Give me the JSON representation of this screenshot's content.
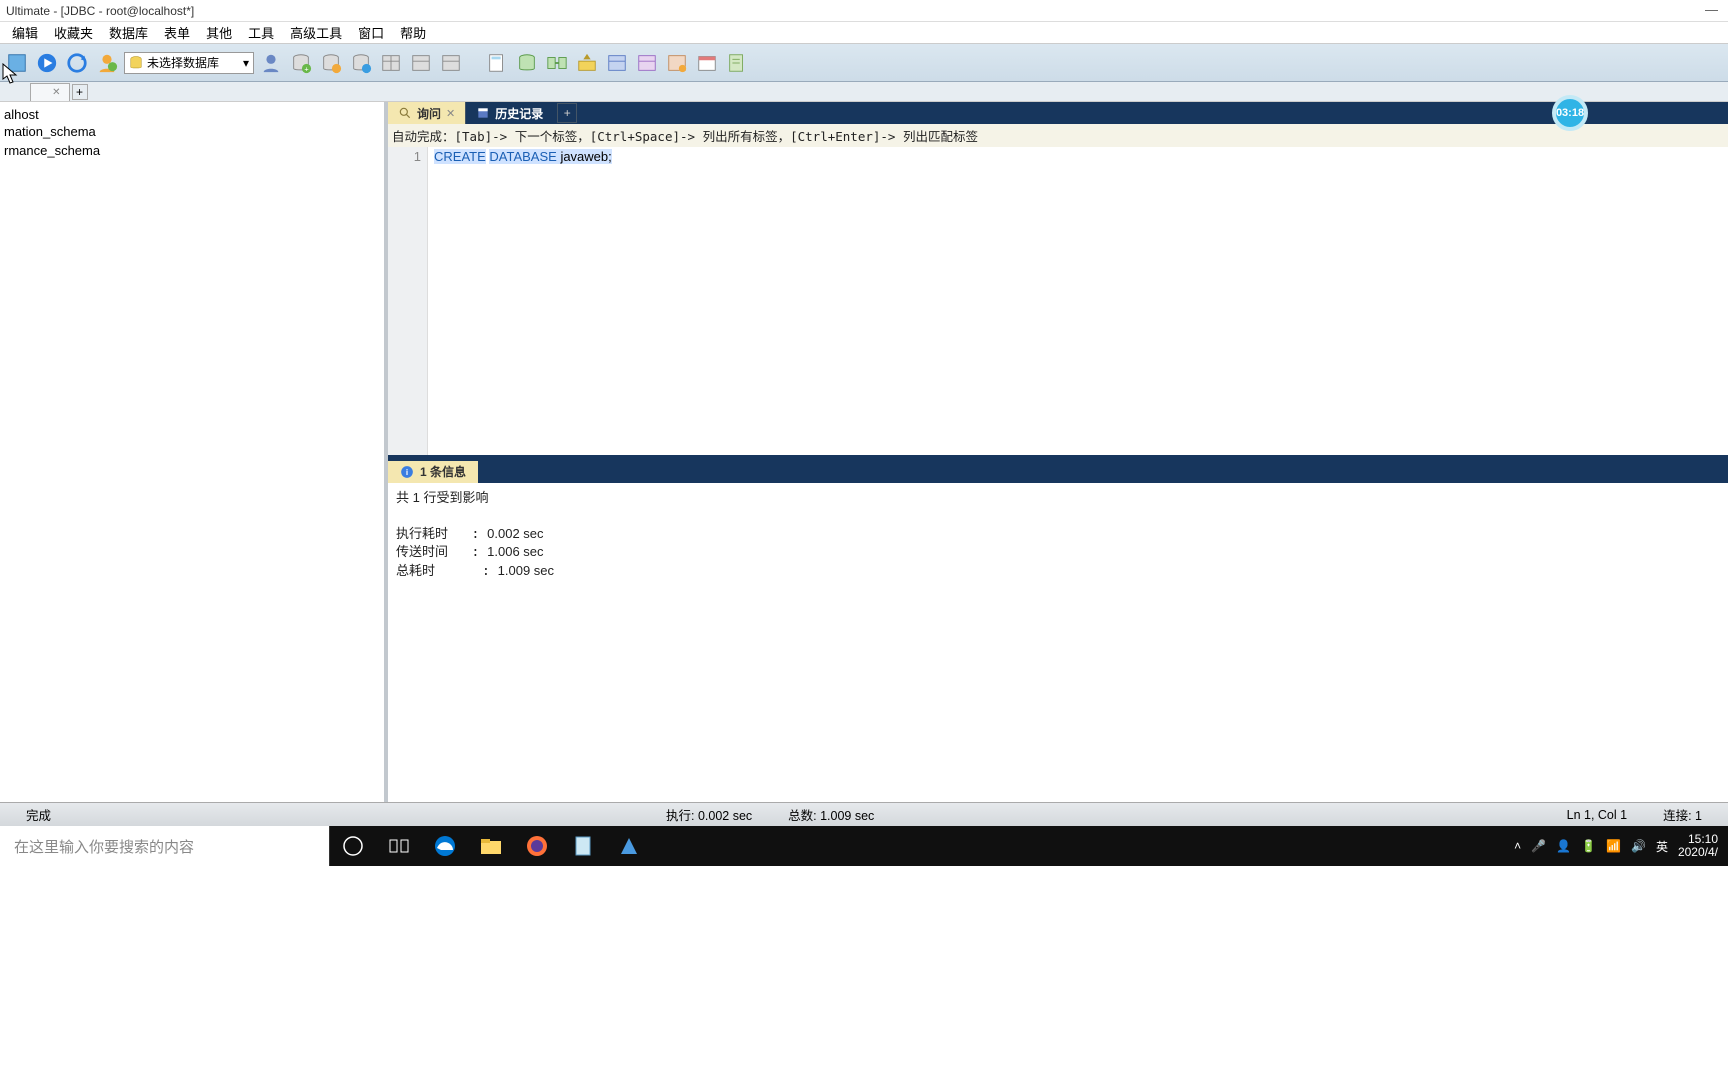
{
  "title": "Ultimate - [JDBC - root@localhost*]",
  "menus": [
    "编辑",
    "收藏夹",
    "数据库",
    "表单",
    "其他",
    "工具",
    "高级工具",
    "窗口",
    "帮助"
  ],
  "dbselect": "未选择数据库",
  "sidebar": {
    "items": [
      "alhost",
      "mation_schema",
      "",
      "rmance_schema"
    ]
  },
  "queryTabs": {
    "active": "询问",
    "history": "历史记录"
  },
  "hint": "自动完成：[Tab]-> 下一个标签，[Ctrl+Space]-> 列出所有标签，[Ctrl+Enter]-> 列出匹配标签",
  "editor": {
    "line": "1",
    "kw1": "CREATE",
    "kw2": "DATABASE",
    "rest": " javaweb;"
  },
  "messages": {
    "tab": "1 条信息",
    "rows": "共 1 行受到影响",
    "exec_label": "执行耗时",
    "exec_val": "0.002 sec",
    "transfer_label": "传送时间",
    "transfer_val": "1.006 sec",
    "total_label": "总耗时",
    "total_val": "1.009 sec"
  },
  "status": {
    "left": "完成",
    "exec": "执行: 0.002 sec",
    "total": "总数: 1.009 sec",
    "pos": "Ln 1, Col 1",
    "conn": "连接: 1"
  },
  "taskbar": {
    "search": "在这里输入你要搜索的内容",
    "ime": "英",
    "time": "15:10",
    "date": "2020/4/"
  },
  "badge": "03:18"
}
